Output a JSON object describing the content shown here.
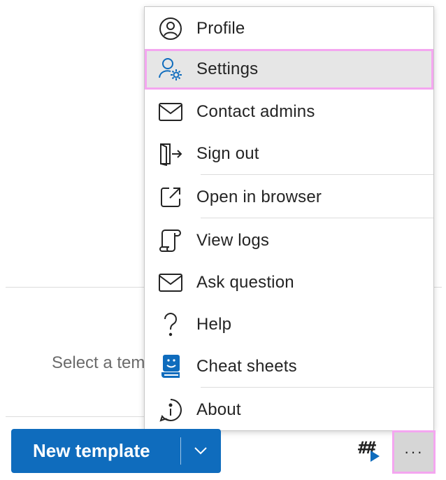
{
  "background": {
    "hint_text": "Select a template"
  },
  "menu": {
    "items": [
      {
        "label": "Profile",
        "icon": "person-circle-icon"
      },
      {
        "label": "Settings",
        "icon": "person-gear-icon"
      },
      {
        "label": "Contact admins",
        "icon": "mail-icon"
      },
      {
        "label": "Sign out",
        "icon": "door-arrow-icon"
      },
      {
        "label": "Open in browser",
        "icon": "open-external-icon"
      },
      {
        "label": "View logs",
        "icon": "scroll-icon"
      },
      {
        "label": "Ask question",
        "icon": "mail-icon"
      },
      {
        "label": "Help",
        "icon": "question-icon"
      },
      {
        "label": "Cheat sheets",
        "icon": "cheat-sheet-icon"
      },
      {
        "label": "About",
        "icon": "info-icon"
      }
    ],
    "highlighted_item": "Settings",
    "highlight_color": "#f4a6f0"
  },
  "toolbar": {
    "new_template_label": "New template",
    "hash_label": "##",
    "more_label": "···"
  },
  "colors": {
    "accent": "#0f6cbd",
    "highlight_outline": "#f4a6f0"
  }
}
